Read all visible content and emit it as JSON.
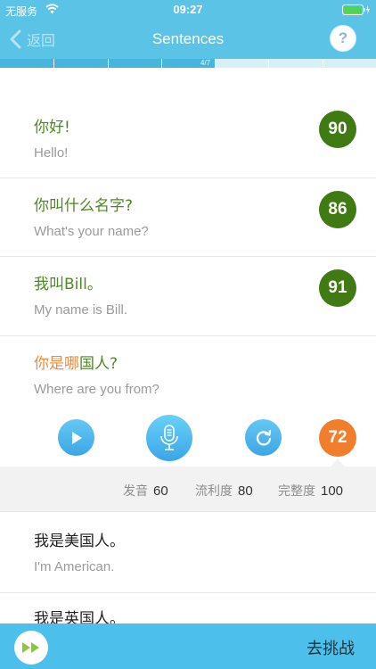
{
  "status_bar": {
    "carrier": "无服务",
    "time": "09:27"
  },
  "nav": {
    "back_label": "返回",
    "title": "Sentences",
    "help": "?"
  },
  "progress": {
    "label": "4/7",
    "current": 4,
    "total": 7,
    "segments": 7
  },
  "sentences": [
    {
      "zh": "你好!",
      "en": "Hello!",
      "score": "90"
    },
    {
      "zh": "你叫什么名字?",
      "en": "What's your name?",
      "score": "86"
    },
    {
      "zh": "我叫Bill。",
      "en": "My name is Bill.",
      "score": "91"
    },
    {
      "zh_parts": [
        "你是哪",
        "国人?"
      ],
      "en": "Where are you from?",
      "score": "72"
    },
    {
      "zh": "我是美国人。",
      "en": "I'm American."
    },
    {
      "zh": "我是英国人。"
    }
  ],
  "metrics": [
    {
      "label": "发音",
      "value": "60"
    },
    {
      "label": "流利度",
      "value": "80"
    },
    {
      "label": "完整度",
      "value": "100"
    }
  ],
  "bottom": {
    "challenge_label": "去挑战"
  },
  "colors": {
    "header": "#5bc4e6",
    "score_green": "#3f7a12",
    "score_orange": "#f07e2c",
    "bottom_bar": "#4cc0ea"
  },
  "icons": [
    "wifi-icon",
    "battery-icon",
    "chevron-left-icon",
    "help-icon",
    "play-icon",
    "microphone-icon",
    "retry-icon",
    "fast-forward-icon"
  ]
}
